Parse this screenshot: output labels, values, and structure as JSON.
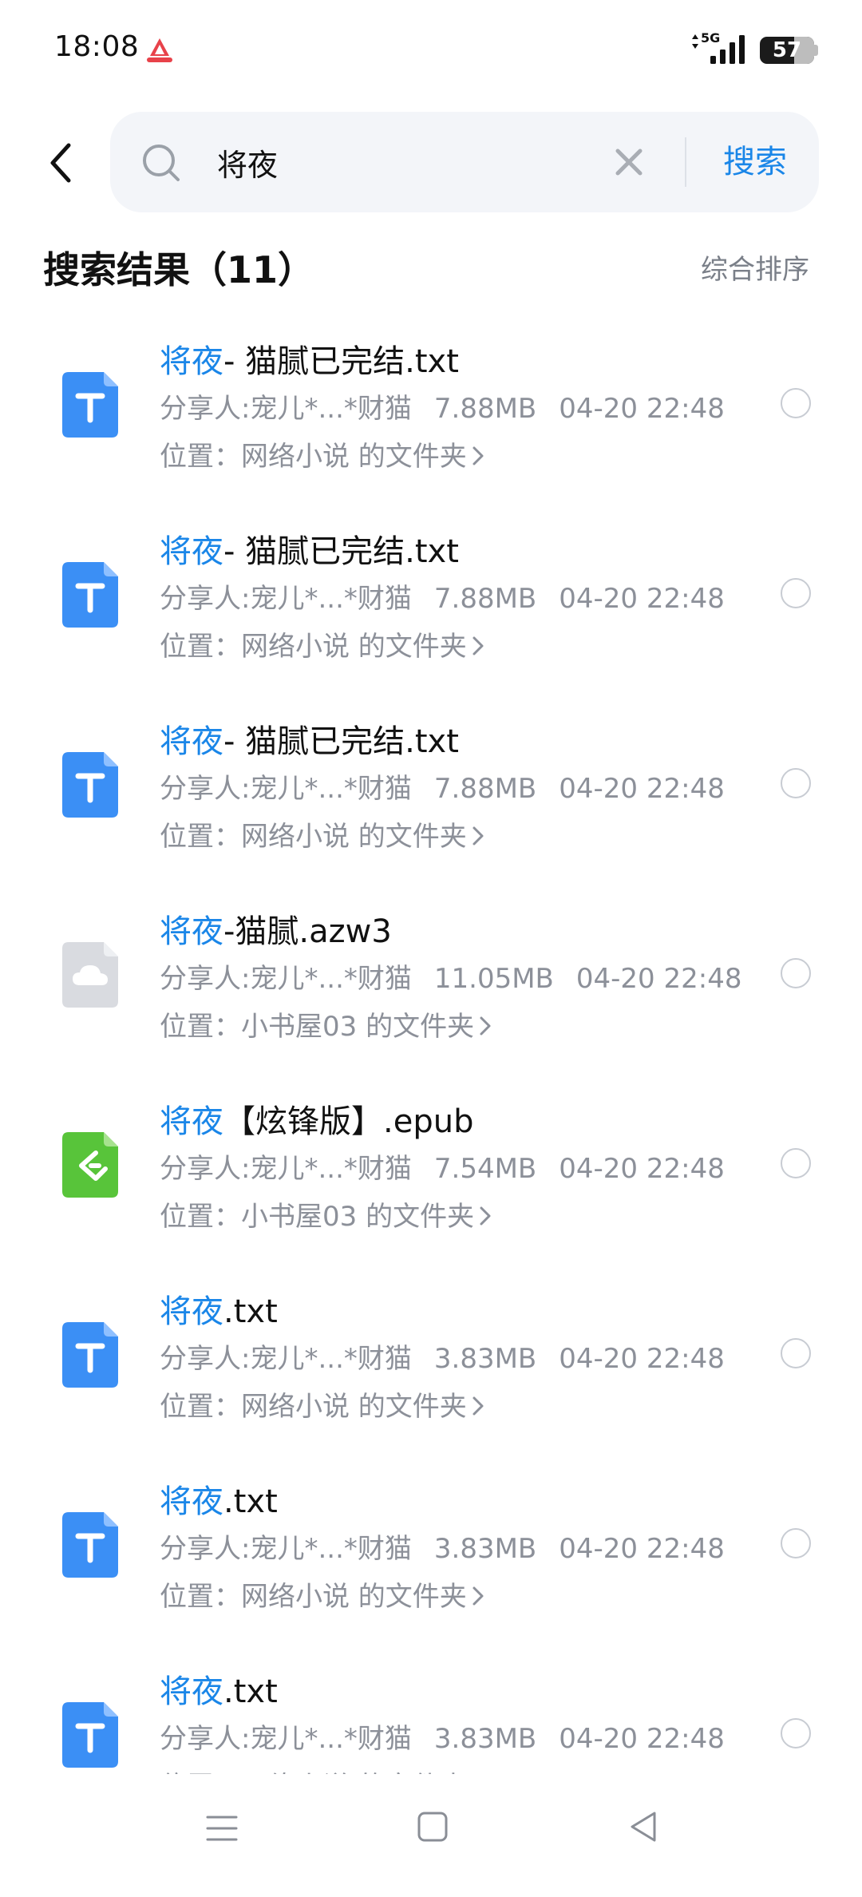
{
  "status_bar": {
    "time": "18:08",
    "network": "5G",
    "battery": "57"
  },
  "search": {
    "query": "将夜",
    "button_label": "搜索"
  },
  "results": {
    "title": "搜索结果（11）",
    "sort_label": "综合排序",
    "items": [
      {
        "highlight": "将夜",
        "title_rest": "- 猫腻已完结.txt",
        "file_type": "txt",
        "sharer": "分享人:宠儿*...*财猫",
        "size": "7.88MB",
        "date": "04-20 22:48",
        "location": "位置：网络小说 的文件夹"
      },
      {
        "highlight": "将夜",
        "title_rest": "- 猫腻已完结.txt",
        "file_type": "txt",
        "sharer": "分享人:宠儿*...*财猫",
        "size": "7.88MB",
        "date": "04-20 22:48",
        "location": "位置：网络小说 的文件夹"
      },
      {
        "highlight": "将夜",
        "title_rest": "- 猫腻已完结.txt",
        "file_type": "txt",
        "sharer": "分享人:宠儿*...*财猫",
        "size": "7.88MB",
        "date": "04-20 22:48",
        "location": "位置：网络小说 的文件夹"
      },
      {
        "highlight": "将夜",
        "title_rest": "-猫腻.azw3",
        "file_type": "cloud",
        "sharer": "分享人:宠儿*...*财猫",
        "size": "11.05MB",
        "date": "04-20 22:48",
        "location": "位置：小书屋03 的文件夹"
      },
      {
        "highlight": "将夜",
        "title_rest": "【炫锋版】.epub",
        "file_type": "epub",
        "sharer": "分享人:宠儿*...*财猫",
        "size": "7.54MB",
        "date": "04-20 22:48",
        "location": "位置：小书屋03 的文件夹"
      },
      {
        "highlight": "将夜",
        "title_rest": ".txt",
        "file_type": "txt",
        "sharer": "分享人:宠儿*...*财猫",
        "size": "3.83MB",
        "date": "04-20 22:48",
        "location": "位置：网络小说 的文件夹"
      },
      {
        "highlight": "将夜",
        "title_rest": ".txt",
        "file_type": "txt",
        "sharer": "分享人:宠儿*...*财猫",
        "size": "3.83MB",
        "date": "04-20 22:48",
        "location": "位置：网络小说 的文件夹"
      },
      {
        "highlight": "将夜",
        "title_rest": ".txt",
        "file_type": "txt",
        "sharer": "分享人:宠儿*...*财猫",
        "size": "3.83MB",
        "date": "04-20 22:48",
        "location": "位置：网络小说 的文件夹"
      }
    ]
  },
  "colors": {
    "accent": "#1a86e8",
    "txt_icon": "#3b8ff5",
    "epub_icon": "#58c43a",
    "cloud_icon": "#d9dbe0",
    "meta_text": "#8c9099"
  },
  "icons": {
    "back": "chevron-left-icon",
    "search": "search-icon",
    "clear": "close-icon",
    "txt": "txt-file-icon",
    "epub": "epub-file-icon",
    "cloud": "cloud-file-icon",
    "location_chevron": "chevron-right-icon",
    "nav_menu": "menu-icon",
    "nav_home": "home-icon",
    "nav_back": "back-triangle-icon"
  }
}
